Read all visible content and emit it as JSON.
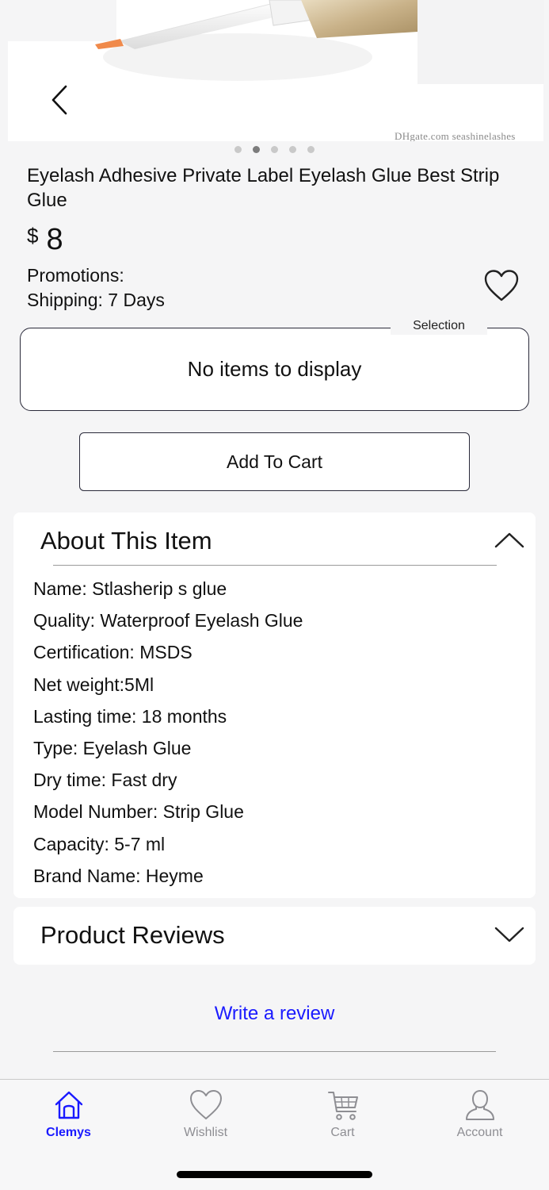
{
  "gallery": {
    "watermark": "DHgate.com  seashinelashes",
    "image_count": 5,
    "active_index": 1
  },
  "product": {
    "title": "Eyelash Adhesive Private Label Eyelash Glue Best Strip Glue",
    "currency": "$",
    "price": "8",
    "promotions": "Promotions:",
    "shipping": "Shipping:  7 Days"
  },
  "selection": {
    "legend": "Selection",
    "empty_text": "No items to display"
  },
  "actions": {
    "add_to_cart": "Add To Cart",
    "write_review": "Write a review"
  },
  "about": {
    "title": "About This Item",
    "expanded": true,
    "specs": [
      "Name: Stlasherip s glue",
      "Quality: Waterproof Eyelash Glue",
      "Certification: MSDS",
      "Net weight:5Ml",
      "Lasting time: 18 months",
      "Type: Eyelash Glue",
      "Dry time: Fast dry",
      "Model Number: Strip Glue",
      "Capacity: 5-7 ml",
      "Brand Name: Heyme"
    ]
  },
  "reviews": {
    "title": "Product Reviews",
    "expanded": false
  },
  "tabbar": {
    "home": "Clemys",
    "wishlist": "Wishlist",
    "cart": "Cart",
    "account": "Account",
    "active": "home"
  },
  "colors": {
    "accent": "#1a1aff",
    "inactive": "#8e8e93",
    "background": "#f5f5f6",
    "border": "#2a2a3a"
  },
  "icons": {
    "back": "chevron-left-icon",
    "wishlist": "heart-outline-icon",
    "about_toggle": "chevron-up-icon",
    "reviews_toggle": "chevron-down-icon",
    "tab_home": "home-icon",
    "tab_wishlist": "heart-icon",
    "tab_cart": "cart-icon",
    "tab_account": "user-icon"
  }
}
